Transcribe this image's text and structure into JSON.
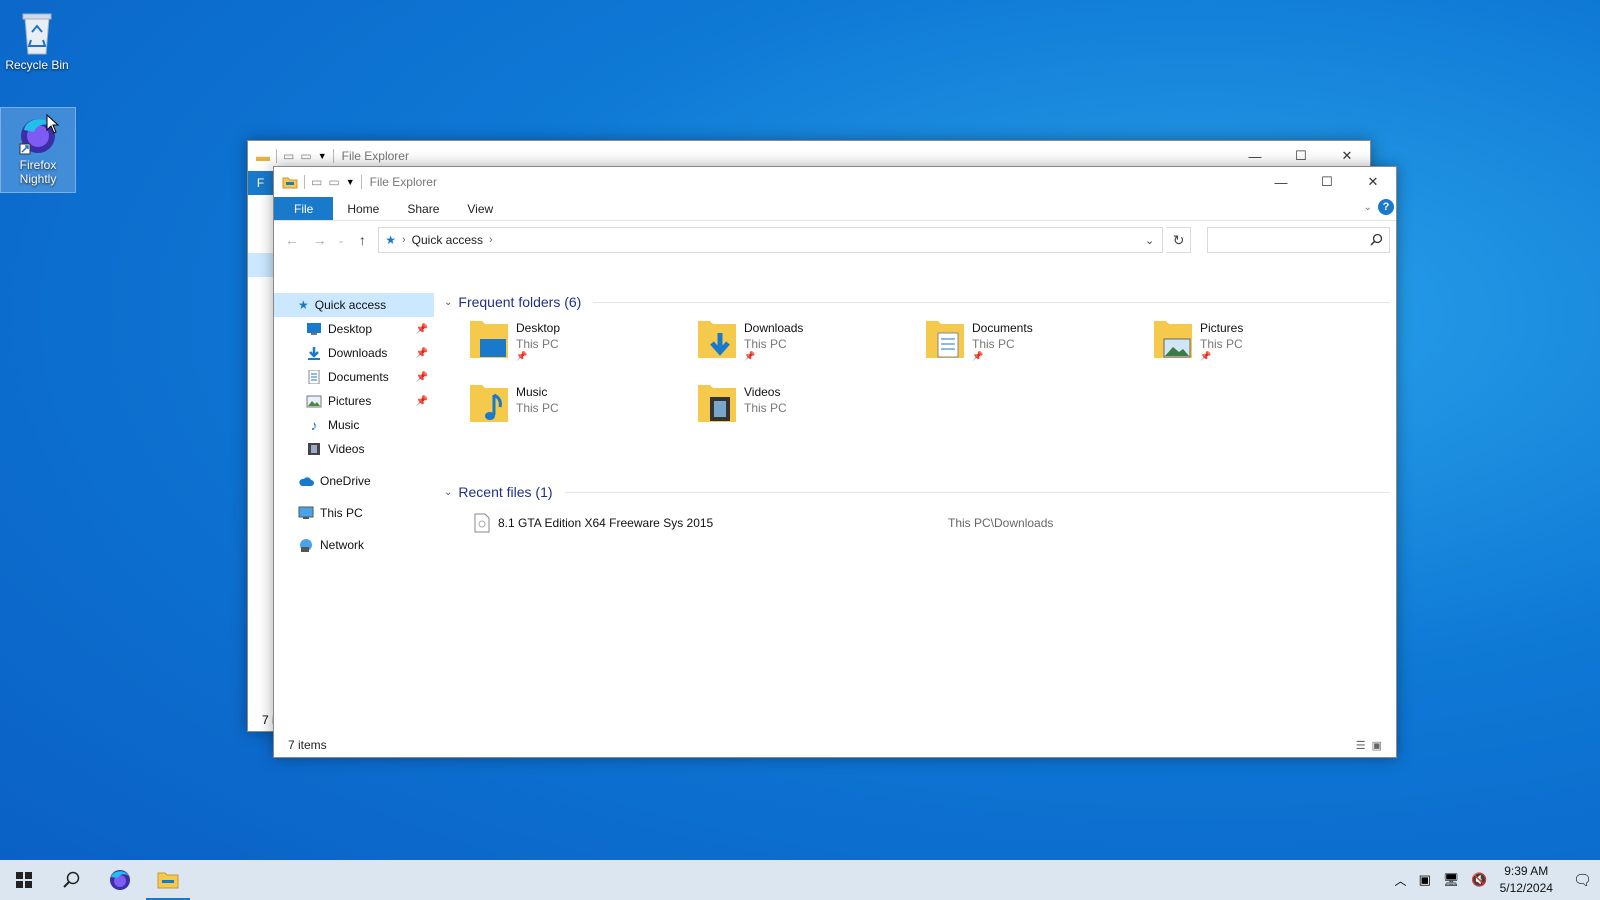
{
  "desktop": {
    "icons": [
      {
        "label": "Recycle Bin"
      },
      {
        "label": "Firefox Nightly"
      }
    ]
  },
  "back_window": {
    "title": "File Explorer",
    "tab_initial": "F",
    "status_partial": "7 i"
  },
  "window": {
    "title": "File Explorer",
    "ribbon_tabs": [
      "File",
      "Home",
      "Share",
      "View"
    ],
    "address": {
      "crumb": "Quick access"
    },
    "search": {
      "value": "",
      "placeholder": ""
    },
    "nav": {
      "quick_access": "Quick access",
      "pinned": [
        {
          "label": "Desktop",
          "pinned": true
        },
        {
          "label": "Downloads",
          "pinned": true
        },
        {
          "label": "Documents",
          "pinned": true
        },
        {
          "label": "Pictures",
          "pinned": true
        },
        {
          "label": "Music",
          "pinned": false
        },
        {
          "label": "Videos",
          "pinned": false
        }
      ],
      "onedrive": "OneDrive",
      "thispc": "This PC",
      "network": "Network"
    },
    "frequent": {
      "header": "Frequent folders (6)",
      "items": [
        {
          "name": "Desktop",
          "location": "This PC",
          "pinned": true
        },
        {
          "name": "Downloads",
          "location": "This PC",
          "pinned": true
        },
        {
          "name": "Documents",
          "location": "This PC",
          "pinned": true
        },
        {
          "name": "Pictures",
          "location": "This PC",
          "pinned": true
        },
        {
          "name": "Music",
          "location": "This PC",
          "pinned": false
        },
        {
          "name": "Videos",
          "location": "This PC",
          "pinned": false
        }
      ]
    },
    "recent": {
      "header": "Recent files (1)",
      "items": [
        {
          "name": "8.1 GTA Edition X64 Freeware Sys 2015",
          "path": "This PC\\Downloads"
        }
      ]
    },
    "status": "7 items"
  },
  "taskbar": {
    "time": "9:39 AM",
    "date": "5/12/2024"
  },
  "colors": {
    "accent": "#1979ca",
    "selection": "#cce8ff",
    "folder": "#f5c94c"
  }
}
